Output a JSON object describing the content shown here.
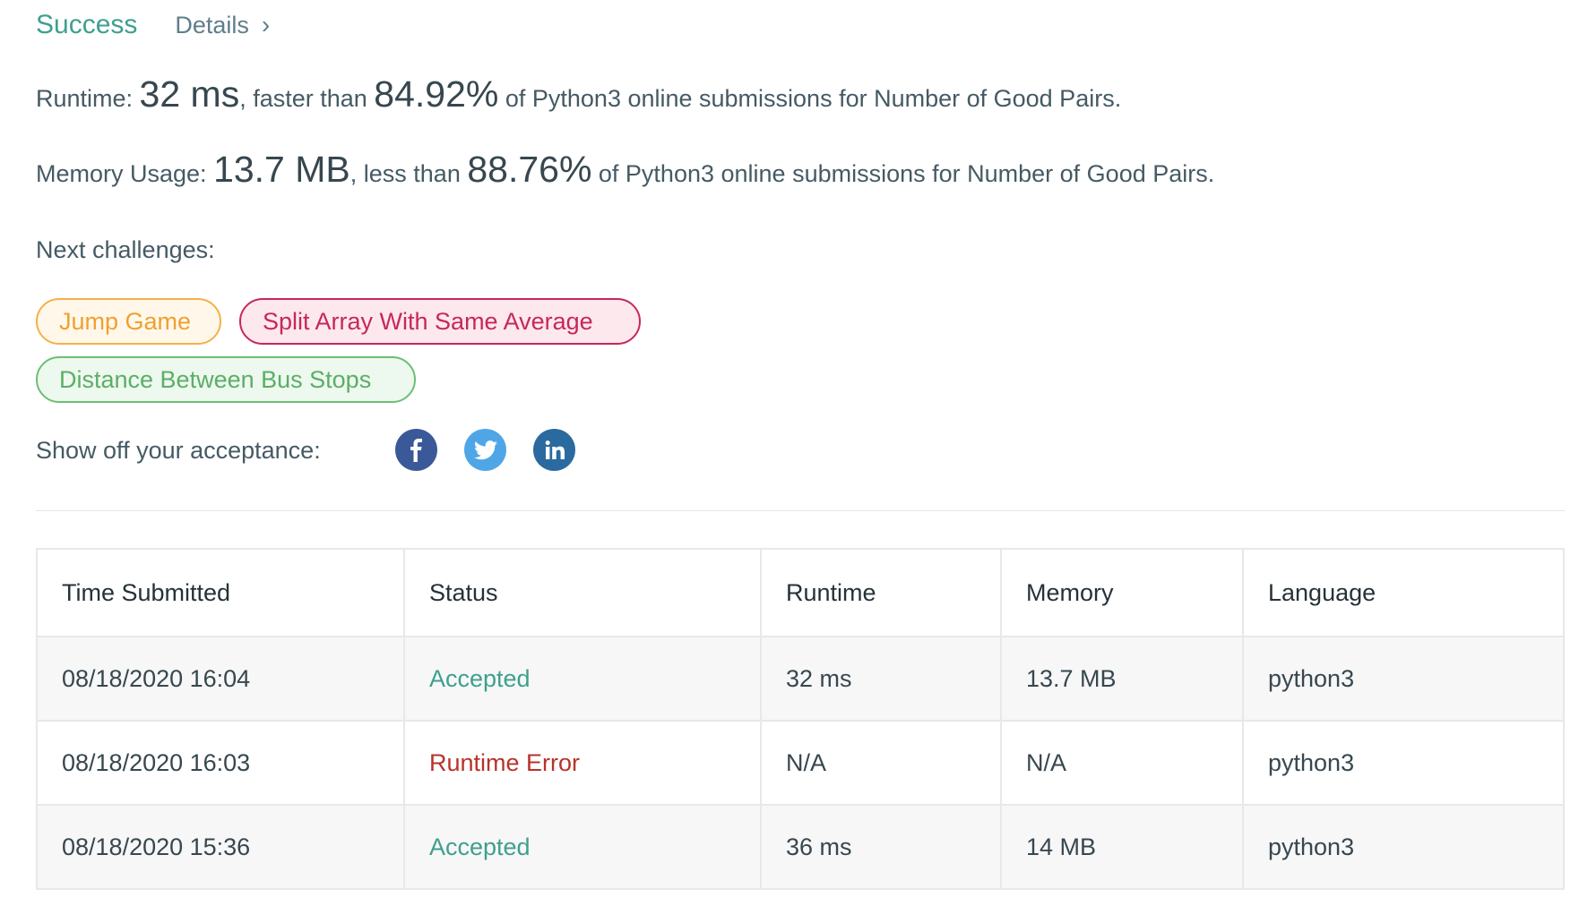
{
  "header": {
    "status": "Success",
    "details_label": "Details"
  },
  "stats": {
    "runtime": {
      "label": "Runtime: ",
      "value": "32 ms",
      "mid": ", faster than ",
      "percent": "84.92%",
      "tail": " of Python3 online submissions for Number of Good Pairs."
    },
    "memory": {
      "label": "Memory Usage: ",
      "value": "13.7 MB",
      "mid": ", less than ",
      "percent": "88.76%",
      "tail": " of Python3 online submissions for Number of Good Pairs."
    }
  },
  "next_challenges": {
    "label": "Next challenges:",
    "items": [
      {
        "title": "Jump Game",
        "difficulty": "easy-color-orange"
      },
      {
        "title": "Split Array With Same Average",
        "difficulty": "hard-color-pink"
      },
      {
        "title": "Distance Between Bus Stops",
        "difficulty": "green"
      }
    ]
  },
  "share": {
    "label": "Show off your acceptance:",
    "icons": [
      "facebook-icon",
      "twitter-icon",
      "linkedin-icon"
    ]
  },
  "submissions": {
    "headers": [
      "Time Submitted",
      "Status",
      "Runtime",
      "Memory",
      "Language"
    ],
    "rows": [
      [
        "08/18/2020 16:04",
        "Accepted",
        "32 ms",
        "13.7 MB",
        "python3"
      ],
      [
        "08/18/2020 16:03",
        "Runtime Error",
        "N/A",
        "N/A",
        "python3"
      ],
      [
        "08/18/2020 15:36",
        "Accepted",
        "36 ms",
        "14 MB",
        "python3"
      ]
    ]
  },
  "colors": {
    "accepted": "#3f9f8f",
    "error": "#b9322a",
    "facebook": "#3b5998",
    "twitter": "#4fa6e6",
    "linkedin": "#2a6a9f"
  }
}
